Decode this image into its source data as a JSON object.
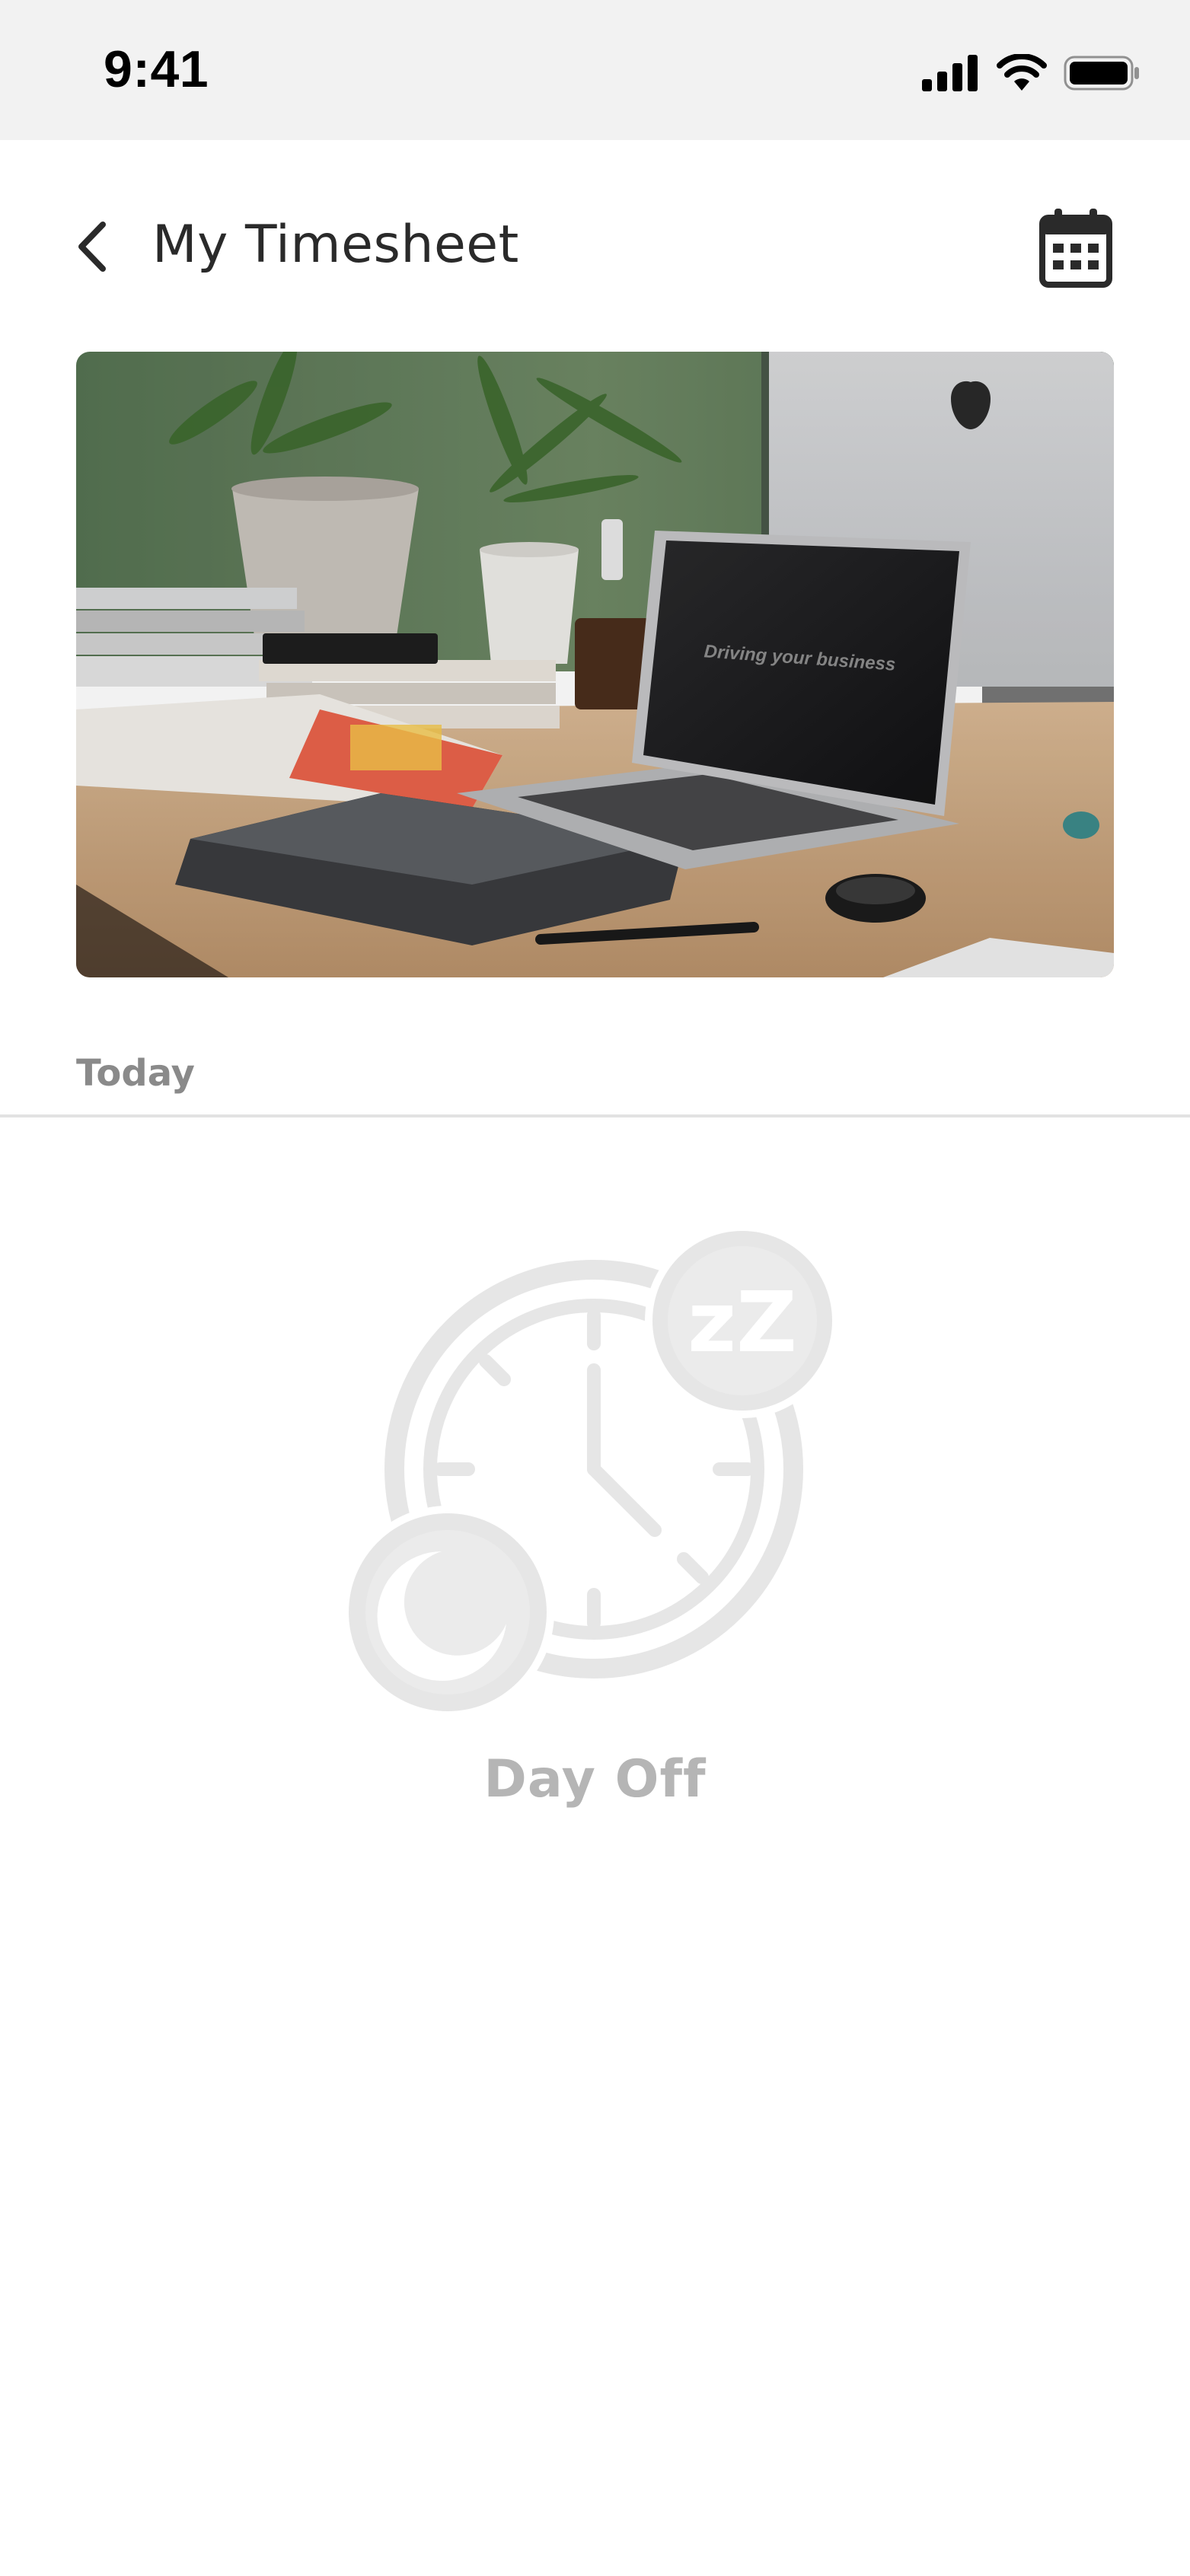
{
  "status_bar": {
    "time": "9:41"
  },
  "header": {
    "title": "My Timesheet",
    "back_icon": "chevron-left-icon",
    "calendar_icon": "calendar-icon"
  },
  "hero": {
    "screen_text": "Driving your business"
  },
  "today_section": {
    "label": "Today"
  },
  "empty_state": {
    "label": "Day Off",
    "icon": "clock-sleep-moon-icon",
    "sleep_text": "zZ"
  },
  "colors": {
    "status_bar_bg": "#f2f2f2",
    "title_text": "#2a2a2a",
    "section_label": "#8a8a8a",
    "divider": "#e2e2e2",
    "empty_icon": "#e6e6e6",
    "empty_label": "#b5b5b5"
  }
}
